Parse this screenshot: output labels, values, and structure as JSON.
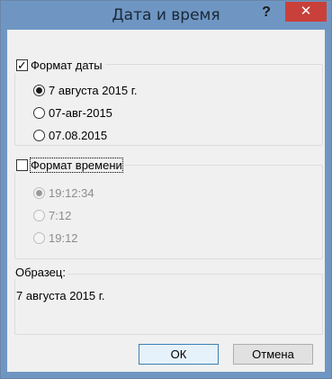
{
  "window": {
    "title": "Дата и время",
    "help_label": "?",
    "close_label": "✕"
  },
  "date_group": {
    "label": "Формат даты",
    "checked": true,
    "options": [
      {
        "label": "7 августа 2015 г.",
        "selected": true
      },
      {
        "label": "07-авг-2015",
        "selected": false
      },
      {
        "label": "07.08.2015",
        "selected": false
      }
    ]
  },
  "time_group": {
    "label": "Формат времени",
    "checked": false,
    "options": [
      {
        "label": "19:12:34",
        "selected": true,
        "disabled": true
      },
      {
        "label": "7:12",
        "selected": false,
        "disabled": true
      },
      {
        "label": "19:12",
        "selected": false,
        "disabled": true
      }
    ]
  },
  "sample": {
    "label": "Образец:",
    "value": "7 августа 2015 г."
  },
  "buttons": {
    "ok_label": "ОК",
    "cancel_label": "Отмена"
  },
  "icons": {
    "check": "checkmark-icon",
    "close": "close-icon"
  },
  "colors": {
    "titlebar": "#6f96c2",
    "close_button": "#c9403a",
    "dialog_bg": "#f0f0f0"
  }
}
